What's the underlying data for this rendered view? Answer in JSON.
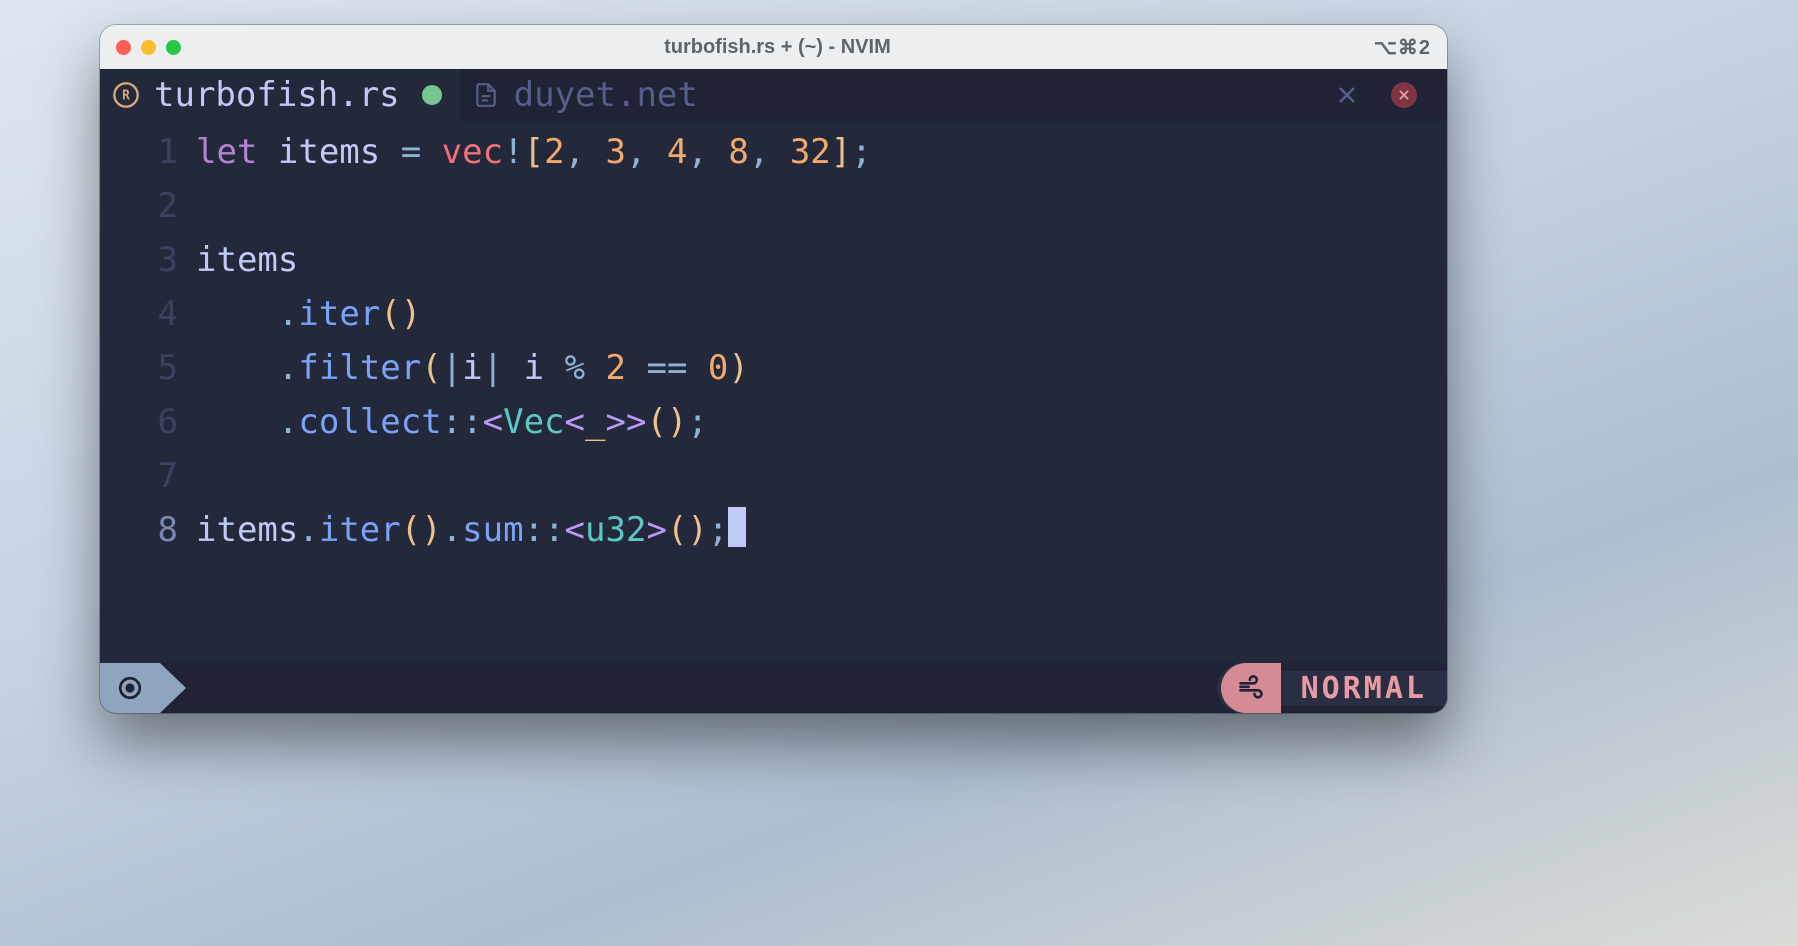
{
  "window": {
    "title": "turbofish.rs + (~) - NVIM",
    "shortcut_indicator": "⌥⌘2"
  },
  "tabs": {
    "active": {
      "icon": "rust-icon",
      "label": "turbofish.rs",
      "modified": true
    },
    "inactive": {
      "icon": "file-icon",
      "label": "duyet.net",
      "close_icon": "close-icon"
    },
    "terminate_icon": "terminate-icon"
  },
  "code": {
    "lines": [
      {
        "n": "1",
        "tokens": [
          {
            "c": "kw",
            "t": "let "
          },
          {
            "c": "id",
            "t": "items "
          },
          {
            "c": "op",
            "t": "= "
          },
          {
            "c": "mac",
            "t": "vec"
          },
          {
            "c": "bang",
            "t": "!"
          },
          {
            "c": "pn",
            "t": "["
          },
          {
            "c": "num",
            "t": "2"
          },
          {
            "c": "op",
            "t": ", "
          },
          {
            "c": "num",
            "t": "3"
          },
          {
            "c": "op",
            "t": ", "
          },
          {
            "c": "num",
            "t": "4"
          },
          {
            "c": "op",
            "t": ", "
          },
          {
            "c": "num",
            "t": "8"
          },
          {
            "c": "op",
            "t": ", "
          },
          {
            "c": "num",
            "t": "32"
          },
          {
            "c": "pn",
            "t": "]"
          },
          {
            "c": "op",
            "t": ";"
          }
        ]
      },
      {
        "n": "2",
        "tokens": []
      },
      {
        "n": "3",
        "tokens": [
          {
            "c": "id",
            "t": "items"
          }
        ]
      },
      {
        "n": "4",
        "tokens": [
          {
            "c": "id",
            "t": "    "
          },
          {
            "c": "op",
            "t": "."
          },
          {
            "c": "fnc",
            "t": "iter"
          },
          {
            "c": "pn",
            "t": "()"
          }
        ]
      },
      {
        "n": "5",
        "tokens": [
          {
            "c": "id",
            "t": "    "
          },
          {
            "c": "op",
            "t": "."
          },
          {
            "c": "fnc",
            "t": "filter"
          },
          {
            "c": "pn",
            "t": "("
          },
          {
            "c": "op",
            "t": "|"
          },
          {
            "c": "id",
            "t": "i"
          },
          {
            "c": "op",
            "t": "| "
          },
          {
            "c": "id",
            "t": "i "
          },
          {
            "c": "op",
            "t": "% "
          },
          {
            "c": "num",
            "t": "2"
          },
          {
            "c": "op",
            "t": " == "
          },
          {
            "c": "num",
            "t": "0"
          },
          {
            "c": "pn",
            "t": ")"
          }
        ]
      },
      {
        "n": "6",
        "tokens": [
          {
            "c": "id",
            "t": "    "
          },
          {
            "c": "op",
            "t": "."
          },
          {
            "c": "fnc",
            "t": "collect"
          },
          {
            "c": "op",
            "t": "::"
          },
          {
            "c": "ang",
            "t": "<"
          },
          {
            "c": "typ",
            "t": "Vec"
          },
          {
            "c": "ang",
            "t": "<"
          },
          {
            "c": "und",
            "t": "_"
          },
          {
            "c": "ang",
            "t": ">>"
          },
          {
            "c": "pn",
            "t": "()"
          },
          {
            "c": "op",
            "t": ";"
          }
        ]
      },
      {
        "n": "7",
        "tokens": []
      },
      {
        "n": "8",
        "cursor_line": true,
        "tokens": [
          {
            "c": "id",
            "t": "items"
          },
          {
            "c": "op",
            "t": "."
          },
          {
            "c": "fnc",
            "t": "iter"
          },
          {
            "c": "pn",
            "t": "()"
          },
          {
            "c": "op",
            "t": "."
          },
          {
            "c": "fnc",
            "t": "sum"
          },
          {
            "c": "op",
            "t": "::"
          },
          {
            "c": "ang",
            "t": "<"
          },
          {
            "c": "typ",
            "t": "u32"
          },
          {
            "c": "ang",
            "t": ">"
          },
          {
            "c": "pn",
            "t": "()"
          },
          {
            "c": "op",
            "t": ";"
          }
        ],
        "cursor_after": true
      }
    ]
  },
  "statusbar": {
    "left_icon": "target-icon",
    "right_icon": "wind-icon",
    "mode": "NORMAL"
  },
  "colors": {
    "bg": "#24283b",
    "bg_dark": "#1f2335",
    "fg": "#c0caf5",
    "keyword": "#b484d1",
    "macro": "#f07178",
    "number": "#f3a96b",
    "function": "#7aa2f7",
    "type": "#5bc8c5",
    "angle": "#bb9af7",
    "punct": "#e9c38a",
    "mode_fg": "#e99aa4"
  }
}
